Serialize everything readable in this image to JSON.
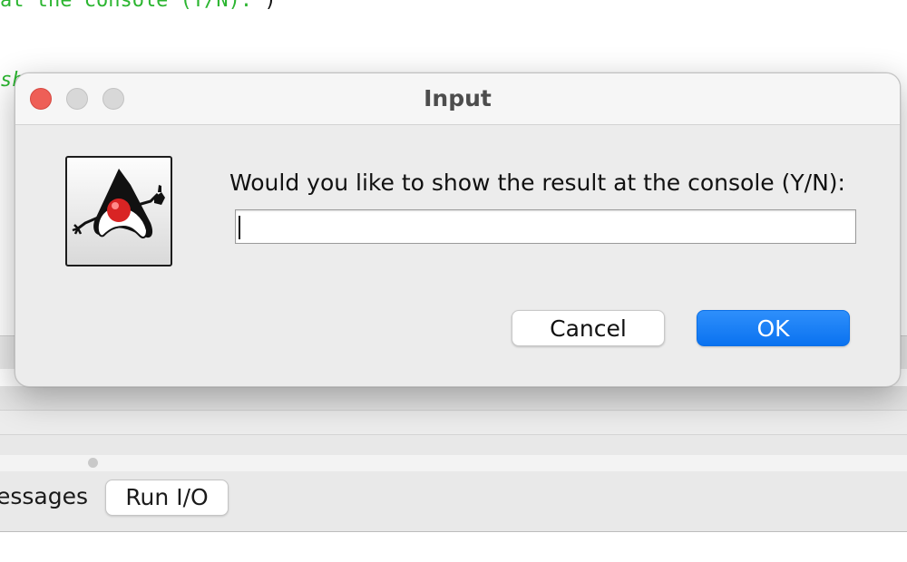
{
  "editor": {
    "code_line_1": "at the console (Y/N): ",
    "code_line_1_paren": ")",
    "code_line_2": "sh"
  },
  "bottom_tabs": {
    "messages_label": "essages",
    "run_io_label": "Run I/O"
  },
  "dialog": {
    "title": "Input",
    "prompt": "Would you like to show the result at the console (Y/N):",
    "input_value": "",
    "cancel_label": "Cancel",
    "ok_label": "OK",
    "icon": "duke-java-icon"
  },
  "colors": {
    "ok_button": "#0a72f0",
    "close_button": "#ee5f57",
    "code_string": "#2bb530"
  }
}
